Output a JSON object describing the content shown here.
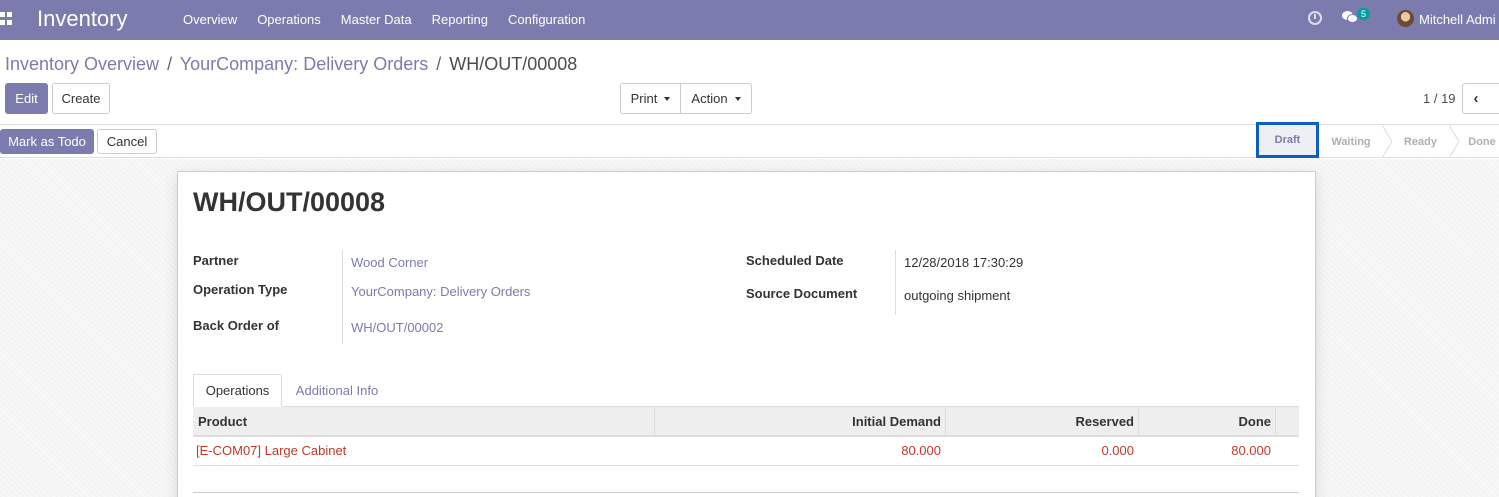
{
  "navbar": {
    "app_name": "Inventory",
    "menu": [
      "Overview",
      "Operations",
      "Master Data",
      "Reporting",
      "Configuration"
    ],
    "chat_count": "5",
    "user_name": "Mitchell Admi"
  },
  "breadcrumb": {
    "items": [
      "Inventory Overview",
      "YourCompany: Delivery Orders"
    ],
    "separator": "/",
    "current": "WH/OUT/00008"
  },
  "buttons": {
    "edit": "Edit",
    "create": "Create",
    "print": "Print",
    "action": "Action",
    "mark_as_todo": "Mark as Todo",
    "cancel": "Cancel"
  },
  "pager": {
    "value": "1 / 19"
  },
  "statusbar": {
    "steps": [
      "Draft",
      "Waiting",
      "Ready",
      "Done"
    ],
    "active": "Draft"
  },
  "record": {
    "title": "WH/OUT/00008",
    "fields_left": [
      {
        "label": "Partner",
        "value": "Wood Corner"
      },
      {
        "label": "Operation Type",
        "value": "YourCompany: Delivery Orders"
      },
      {
        "label": "Back Order of",
        "value": "WH/OUT/00002"
      }
    ],
    "fields_right": [
      {
        "label": "Scheduled Date",
        "value": "12/28/2018 17:30:29"
      },
      {
        "label": "Source Document",
        "value": "outgoing shipment"
      }
    ]
  },
  "tabs": [
    "Operations",
    "Additional Info"
  ],
  "table": {
    "columns": [
      "Product",
      "Initial Demand",
      "Reserved",
      "Done"
    ],
    "rows": [
      {
        "product": "[E-COM07] Large Cabinet",
        "initial_demand": "80.000",
        "reserved": "0.000",
        "done": "80.000"
      }
    ]
  },
  "colors": {
    "navbar": "#7c7bad",
    "link": "#7c7bad",
    "row_text": "#c0392b",
    "highlight_border": "#0a5ec6"
  }
}
